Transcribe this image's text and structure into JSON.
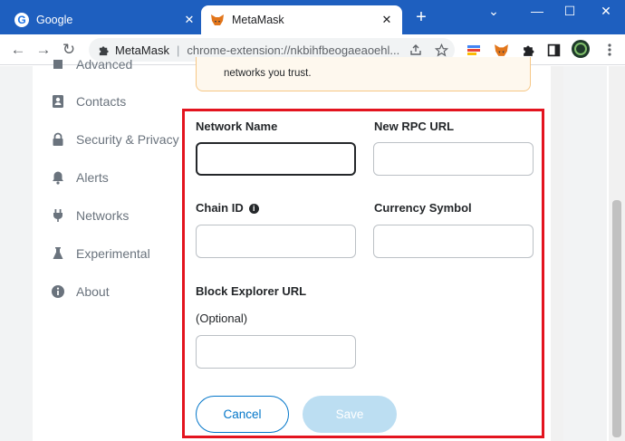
{
  "browser": {
    "tabs": [
      {
        "title": "Google",
        "icon": "google-icon",
        "active": false
      },
      {
        "title": "MetaMask",
        "icon": "metamask-fox-icon",
        "active": true
      }
    ],
    "omnibox": {
      "site_name": "MetaMask",
      "separator": "|",
      "url": "chrome-extension://nkbihfbeogaeaoehl..."
    }
  },
  "sidebar": {
    "items": [
      {
        "label": "Advanced",
        "icon": "advanced-icon"
      },
      {
        "label": "Contacts",
        "icon": "contacts-icon"
      },
      {
        "label": "Security & Privacy",
        "icon": "lock-icon"
      },
      {
        "label": "Alerts",
        "icon": "bell-icon"
      },
      {
        "label": "Networks",
        "icon": "plug-icon"
      },
      {
        "label": "Experimental",
        "icon": "flask-icon"
      },
      {
        "label": "About",
        "icon": "info-icon"
      }
    ]
  },
  "warning": {
    "text": "networks you trust."
  },
  "form": {
    "network_name": {
      "label": "Network Name",
      "value": ""
    },
    "rpc_url": {
      "label": "New RPC URL",
      "value": ""
    },
    "chain_id": {
      "label": "Chain ID",
      "value": ""
    },
    "currency_symbol": {
      "label": "Currency Symbol",
      "value": ""
    },
    "block_explorer": {
      "label": "Block Explorer URL",
      "sublabel": "(Optional)",
      "value": ""
    },
    "cancel_label": "Cancel",
    "save_label": "Save"
  },
  "colors": {
    "chrome_frame": "#1e5fbf",
    "highlight": "#e3141f",
    "primary": "#0376c9",
    "save_disabled": "#bcdef2",
    "warning_bg": "#fef8ee",
    "warning_border": "#f6c786"
  }
}
